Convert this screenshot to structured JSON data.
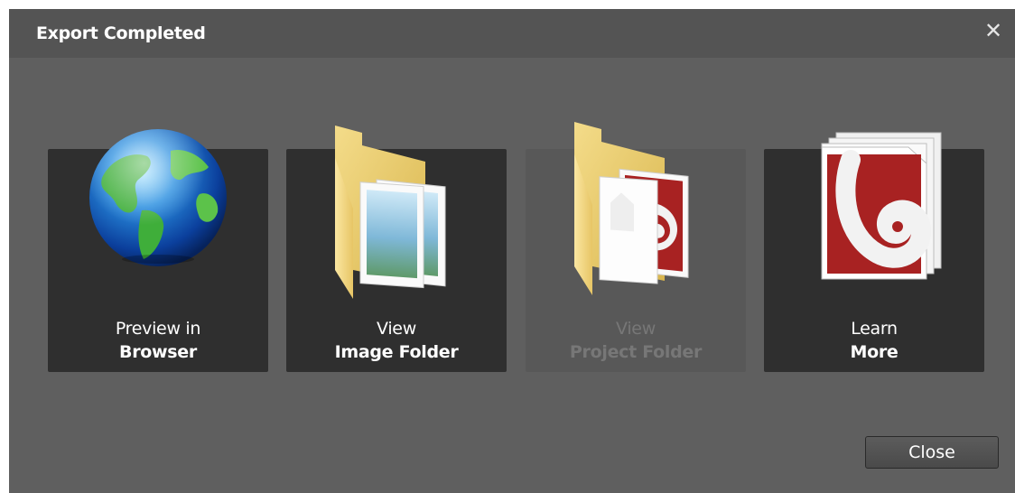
{
  "dialog": {
    "title": "Export Completed",
    "close_glyph": "✕"
  },
  "tiles": [
    {
      "line1": "Preview in",
      "line2": "Browser",
      "icon": "globe-icon",
      "enabled": true
    },
    {
      "line1": "View",
      "line2": "Image Folder",
      "icon": "image-folder-icon",
      "enabled": true
    },
    {
      "line1": "View",
      "line2": "Project Folder",
      "icon": "project-folder-icon",
      "enabled": false
    },
    {
      "line1": "Learn",
      "line2": "More",
      "icon": "document-stack-icon",
      "enabled": true
    }
  ],
  "footer": {
    "close_label": "Close"
  },
  "colors": {
    "dialog_bg": "#5f5f5f",
    "titlebar_bg": "#545454",
    "tile_bg": "#2f2f2f",
    "tile_disabled_bg": "#585858",
    "text": "#ffffff",
    "disabled_text": "#777777"
  }
}
